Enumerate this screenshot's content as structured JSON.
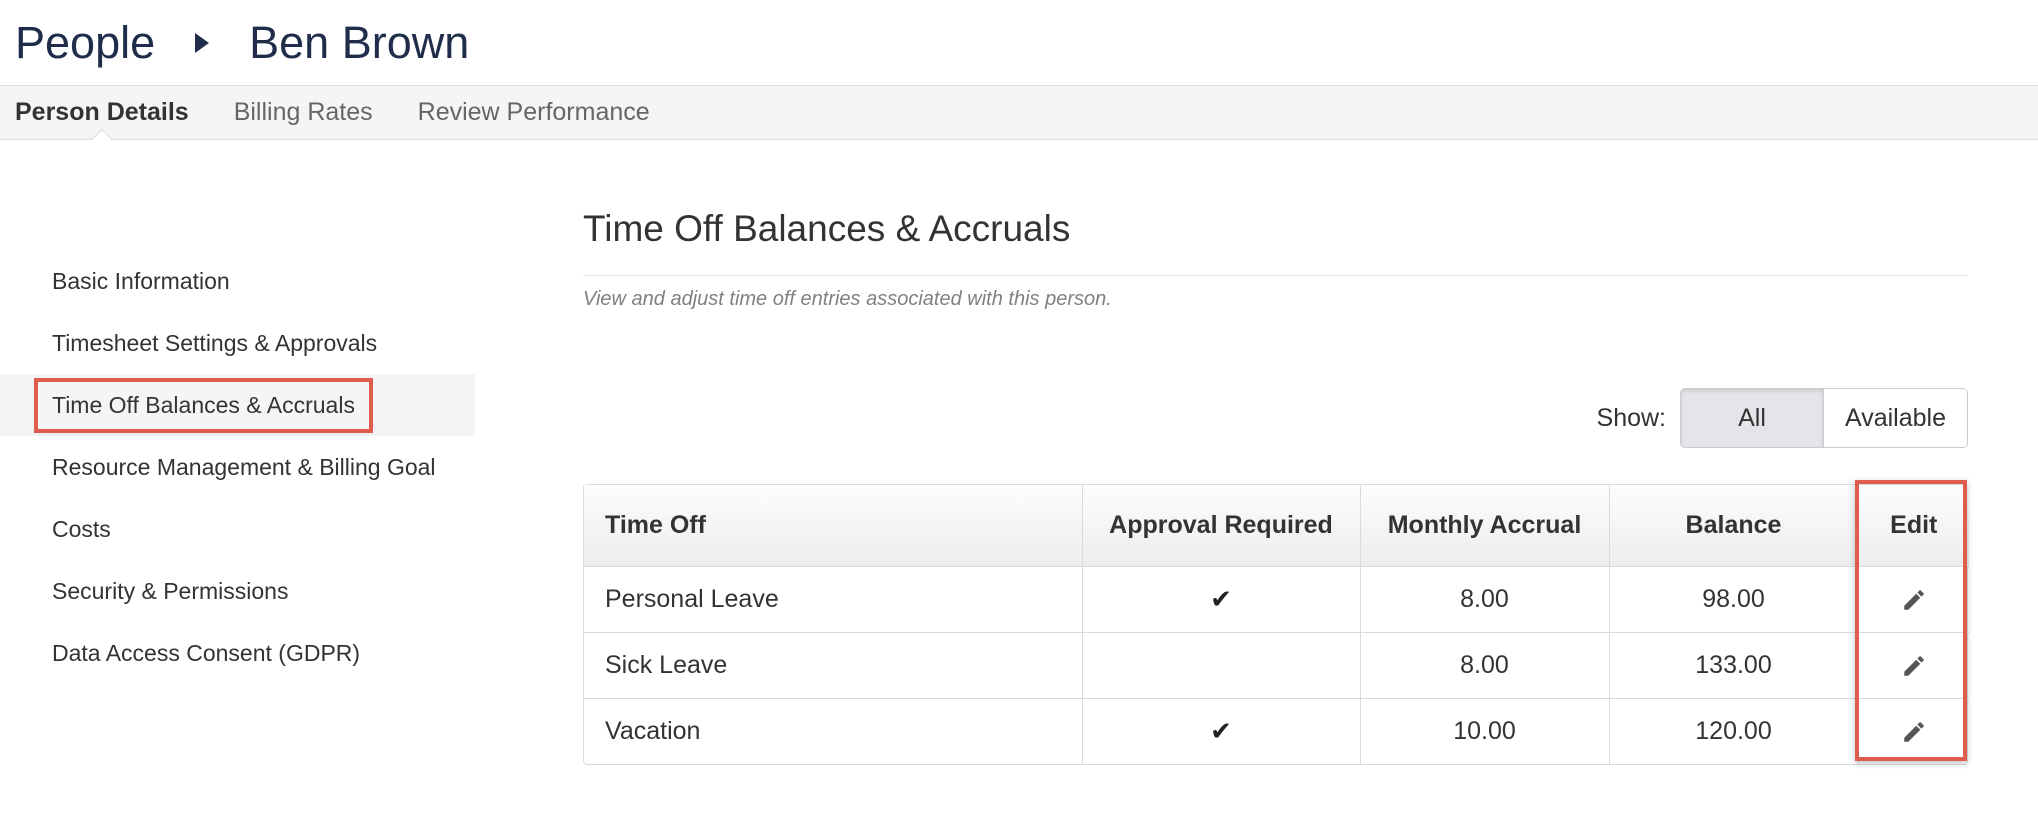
{
  "breadcrumb": {
    "root": "People",
    "current": "Ben Brown"
  },
  "tabs": [
    {
      "label": "Person Details",
      "active": true
    },
    {
      "label": "Billing Rates",
      "active": false
    },
    {
      "label": "Review Performance",
      "active": false
    }
  ],
  "sidebar": {
    "items": [
      {
        "label": "Basic Information"
      },
      {
        "label": "Timesheet Settings & Approvals"
      },
      {
        "label": "Time Off Balances & Accruals",
        "active": true
      },
      {
        "label": "Resource Management & Billing Goal"
      },
      {
        "label": "Costs"
      },
      {
        "label": "Security & Permissions"
      },
      {
        "label": "Data Access Consent (GDPR)"
      }
    ]
  },
  "main": {
    "title": "Time Off Balances & Accruals",
    "description": "View and adjust time off entries associated with this person.",
    "filter": {
      "label": "Show:",
      "options": [
        "All",
        "Available"
      ],
      "selected": "All"
    },
    "table": {
      "headers": [
        "Time Off",
        "Approval Required",
        "Monthly Accrual",
        "Balance",
        "Edit"
      ],
      "rows": [
        {
          "name": "Personal Leave",
          "approval": "✔",
          "accrual": "8.00",
          "balance": "98.00"
        },
        {
          "name": "Sick Leave",
          "approval": "",
          "accrual": "8.00",
          "balance": "133.00"
        },
        {
          "name": "Vacation",
          "approval": "✔",
          "accrual": "10.00",
          "balance": "120.00"
        }
      ]
    }
  },
  "colors": {
    "highlight": "#e05c4f",
    "breadcrumb": "#1f2d4a"
  }
}
